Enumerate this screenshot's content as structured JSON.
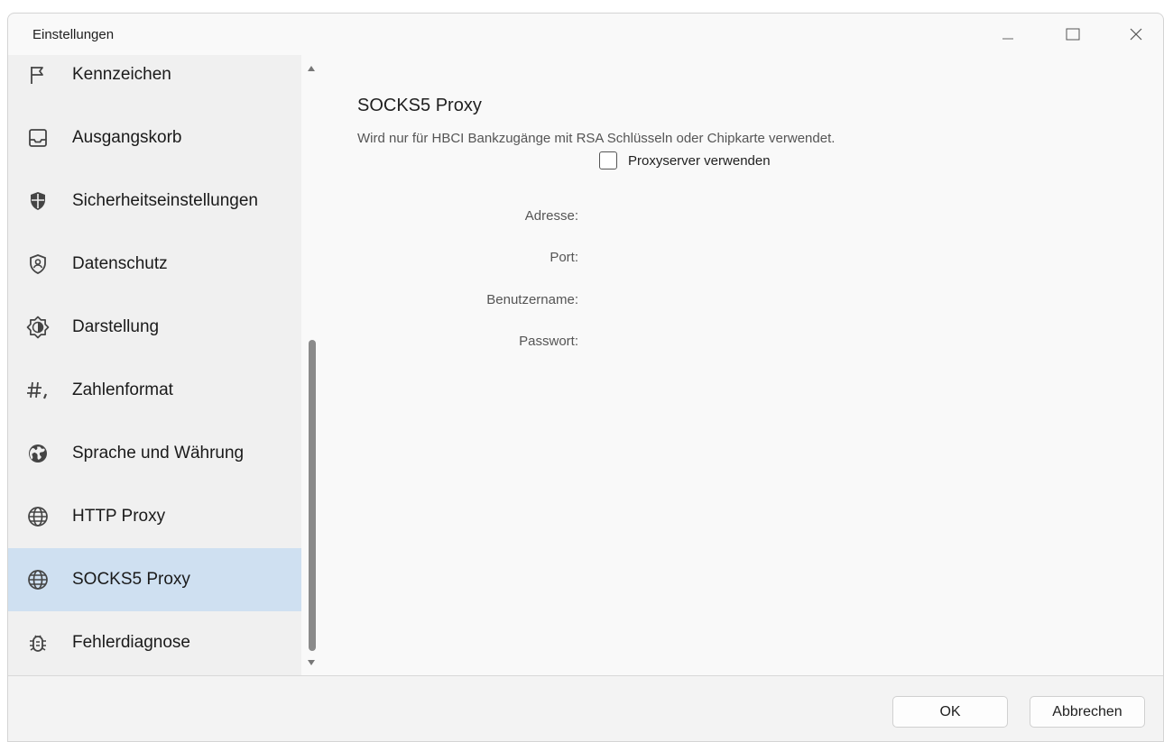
{
  "window": {
    "title": "Einstellungen"
  },
  "sidebar": {
    "items": [
      {
        "label": "Kennzeichen",
        "icon": "flag-icon"
      },
      {
        "label": "Ausgangskorb",
        "icon": "tray-icon"
      },
      {
        "label": "Sicherheitseinstellungen",
        "icon": "shield-icon"
      },
      {
        "label": "Datenschutz",
        "icon": "privacy-shield-icon"
      },
      {
        "label": "Darstellung",
        "icon": "brightness-icon"
      },
      {
        "label": "Zahlenformat",
        "icon": "number-format-icon"
      },
      {
        "label": "Sprache und Währung",
        "icon": "globe-icon"
      },
      {
        "label": "HTTP Proxy",
        "icon": "globe-grid-icon"
      },
      {
        "label": "SOCKS5 Proxy",
        "icon": "globe-grid-icon"
      },
      {
        "label": "Fehlerdiagnose",
        "icon": "bug-icon"
      }
    ],
    "selected": "SOCKS5 Proxy"
  },
  "main": {
    "title": "SOCKS5 Proxy",
    "description": "Wird nur für HBCI Bankzugänge mit RSA Schlüsseln oder Chipkarte verwendet.",
    "checkbox": {
      "label": "Proxyserver verwenden",
      "checked": false
    },
    "fields": {
      "address": "Adresse:",
      "port": "Port:",
      "username": "Benutzername:",
      "password": "Passwort:"
    }
  },
  "footer": {
    "ok_label": "OK",
    "cancel_label": "Abbrechen"
  },
  "colors": {
    "selected": "#cfe0f1",
    "sidebar_bg": "#f0f0f0",
    "footer_bg": "#f3f3f3"
  }
}
